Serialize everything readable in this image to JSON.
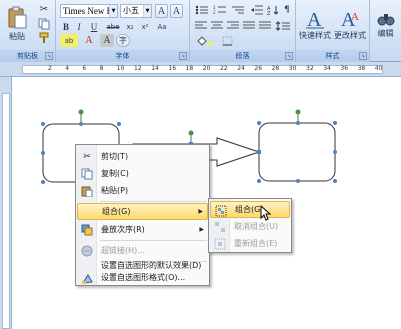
{
  "ribbon": {
    "clipboard": {
      "paste_label": "粘贴",
      "group_label": "剪贴板"
    },
    "font": {
      "font_name": "Times New F",
      "font_size": "小五",
      "bold": "B",
      "italic": "I",
      "underline": "U",
      "strike": "abe",
      "subscript": "x₂",
      "superscript": "x²",
      "clear": "Aa",
      "highlight": "ab",
      "font_color": "A",
      "char_shade": "A",
      "enclose": "字",
      "grow": "A",
      "char_border": "A",
      "group_label": "字体"
    },
    "paragraph": {
      "group_label": "段落"
    },
    "styles": {
      "quick_styles_label": "快速样式",
      "change_styles_label": "更改样式",
      "group_label": "样式"
    },
    "edit": {
      "label": "编辑"
    }
  },
  "ruler": {
    "ticks": [
      "2",
      "4",
      "6",
      "8",
      "10",
      "12",
      "14",
      "16",
      "18",
      "20",
      "22",
      "24",
      "26",
      "28",
      "30",
      "32",
      "34",
      "36",
      "38",
      "40"
    ]
  },
  "context_menu": {
    "items": [
      {
        "label": "剪切(T)",
        "icon": "scissors-icon",
        "disabled": false
      },
      {
        "label": "复制(C)",
        "icon": "copy-icon",
        "disabled": false
      },
      {
        "label": "粘贴(P)",
        "icon": "paste-icon",
        "disabled": false
      },
      {
        "label": "组合(G)",
        "icon": "",
        "disabled": false,
        "submenu": true,
        "highlighted": true
      },
      {
        "label": "叠放次序(R)",
        "icon": "order-icon",
        "disabled": false,
        "submenu": true
      },
      {
        "label": "超链接(H)...",
        "icon": "hyperlink-icon",
        "disabled": true
      },
      {
        "label": "设置自选图形的默认效果(D)",
        "icon": "",
        "disabled": false
      },
      {
        "label": "设置自选图形格式(O)...",
        "icon": "format-shape-icon",
        "disabled": false
      }
    ]
  },
  "submenu": {
    "items": [
      {
        "label": "组合(G)",
        "icon": "group-icon",
        "disabled": false,
        "highlighted": true
      },
      {
        "label": "取消组合(U)",
        "icon": "ungroup-icon",
        "disabled": true
      },
      {
        "label": "重新组合(E)",
        "icon": "regroup-icon",
        "disabled": true
      }
    ]
  },
  "colors": {
    "accent_highlight": "#fbd96d",
    "ribbon_bg": "#d3e2f5",
    "shape_line": "#333333",
    "handle_blue": "#4f81bd",
    "rotate_green": "#3c9a3c",
    "font_color_red": "#d42020"
  }
}
